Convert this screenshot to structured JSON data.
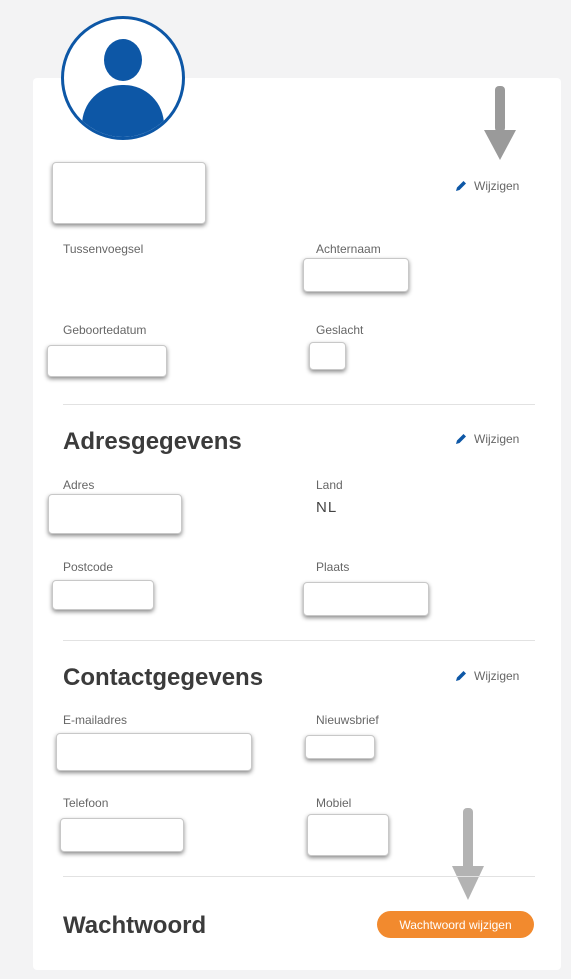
{
  "personal": {
    "edit_label": "Wijzigen",
    "tussenvoegsel_label": "Tussenvoegsel",
    "achternaam_label": "Achternaam",
    "geboortedatum_label": "Geboortedatum",
    "geslacht_label": "Geslacht"
  },
  "address": {
    "title": "Adresgegevens",
    "edit_label": "Wijzigen",
    "adres_label": "Adres",
    "land_label": "Land",
    "land_value": "NL",
    "postcode_label": "Postcode",
    "plaats_label": "Plaats"
  },
  "contact": {
    "title": "Contactgegevens",
    "edit_label": "Wijzigen",
    "email_label": "E-mailadres",
    "nieuwsbrief_label": "Nieuwsbrief",
    "telefoon_label": "Telefoon",
    "mobiel_label": "Mobiel"
  },
  "password": {
    "title": "Wachtwoord",
    "button_label": "Wachtwoord wijzigen"
  },
  "colors": {
    "accent_blue": "#0d57a6",
    "button_orange": "#f28a2e",
    "arrow_gray": "#9a9a9a"
  }
}
